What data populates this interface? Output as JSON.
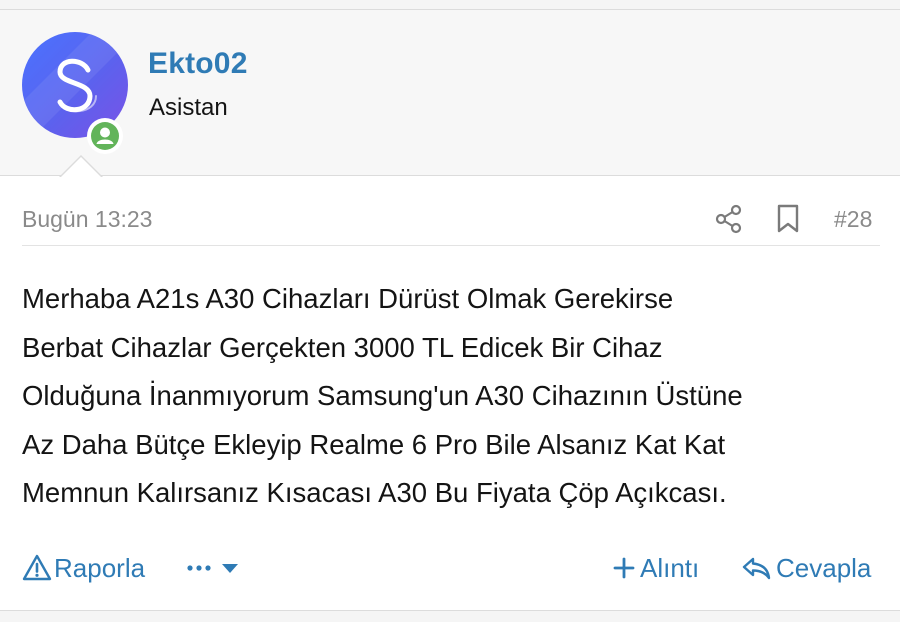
{
  "user": {
    "name": "Ekto02",
    "title": "Asistan"
  },
  "post": {
    "date": "Bugün 13:23",
    "number": "#28",
    "body": "Merhaba A21s A30 Cihazları Dürüst Olmak Gerekirse\nBerbat Cihazlar Gerçekten 3000 TL Edicek Bir Cihaz\nOlduğuna İnanmıyorum Samsung'un A30 Cihazının Üstüne\nAz Daha Bütçe Ekleyip Realme 6 Pro Bile Alsanız Kat Kat\nMemnun Kalırsanız Kısacası A30 Bu Fiyata Çöp Açıkcası."
  },
  "actions": {
    "report_label": "Raporla",
    "quote_label": "Alıntı",
    "reply_label": "Cevapla"
  },
  "icons": {
    "report": "warning-triangle-icon",
    "more": "ellipsis-icon",
    "dropdown": "caret-down-icon",
    "quote": "plus-icon",
    "reply": "reply-arrow-icon",
    "share": "share-icon",
    "bookmark": "bookmark-icon",
    "online": "user-online-icon"
  },
  "colors": {
    "link": "#2f7bb5",
    "meta": "#8a8a8a",
    "online": "#62b45a",
    "avatar_start": "#4a73ff",
    "avatar_end": "#7a52e6"
  }
}
